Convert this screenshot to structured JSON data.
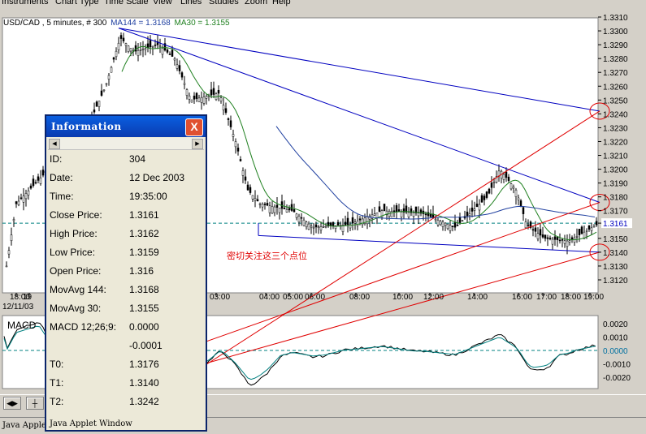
{
  "menu": [
    "Instruments",
    "Chart Type",
    "Time Scale",
    "View",
    "Lines",
    "Studies",
    "Zoom",
    "Help"
  ],
  "legend": {
    "symbol": "USD/CAD , 5 minutes, # 300",
    "ma144": "MA144 = 1.3168",
    "ma30": "MA30 = 1.3155"
  },
  "colors": {
    "ma144": "#2040a0",
    "ma30": "#208020",
    "trend": "#0000c0",
    "red": "#e00000",
    "teal": "#008080"
  },
  "price_axis": [
    "1.3310",
    "1.3300",
    "1.3290",
    "1.3280",
    "1.3270",
    "1.3260",
    "1.3250",
    "1.3240",
    "1.3230",
    "1.3220",
    "1.3210",
    "1.3200",
    "1.3190",
    "1.3180",
    "1.3170",
    "1.3161",
    "1.3150",
    "1.3140",
    "1.3130",
    "1.3120"
  ],
  "time_axis": [
    "18:00",
    "19",
    "03:00",
    "04:00",
    "05:00",
    "06:00",
    "08:00",
    "10:00",
    "12:00",
    "14:00",
    "16:00",
    "17:00",
    "18:00",
    "19:00"
  ],
  "date_label": "12/11/03",
  "macd": {
    "label": "MACD",
    "axis": [
      "0.0020",
      "0.0010",
      "0.0000",
      "-0.0010",
      "-0.0020"
    ]
  },
  "annotation": "密切关注这三个点位",
  "info": {
    "title": "Information",
    "close": "X",
    "rows": [
      {
        "k": "ID:",
        "v": "304"
      },
      {
        "k": "Date:",
        "v": "12 Dec 2003"
      },
      {
        "k": "Time:",
        "v": "19:35:00"
      },
      {
        "k": "Close Price:",
        "v": "1.3161"
      },
      {
        "k": "High Price:",
        "v": "1.3162"
      },
      {
        "k": "Low Price:",
        "v": "1.3159"
      },
      {
        "k": "Open Price:",
        "v": "1.316"
      },
      {
        "k": "MovAvg 144:",
        "v": "1.3168"
      },
      {
        "k": "MovAvg 30:",
        "v": "1.3155"
      },
      {
        "k": "MACD 12;26;9:",
        "v": "0.0000"
      },
      {
        "k": "",
        "v": "-0.0001"
      },
      {
        "k": "T0:",
        "v": "1.3176"
      },
      {
        "k": "T1:",
        "v": "1.3140"
      },
      {
        "k": "T2:",
        "v": "1.3242"
      }
    ],
    "footer": "Java Applet Window"
  },
  "status": "Java Applet Window"
}
